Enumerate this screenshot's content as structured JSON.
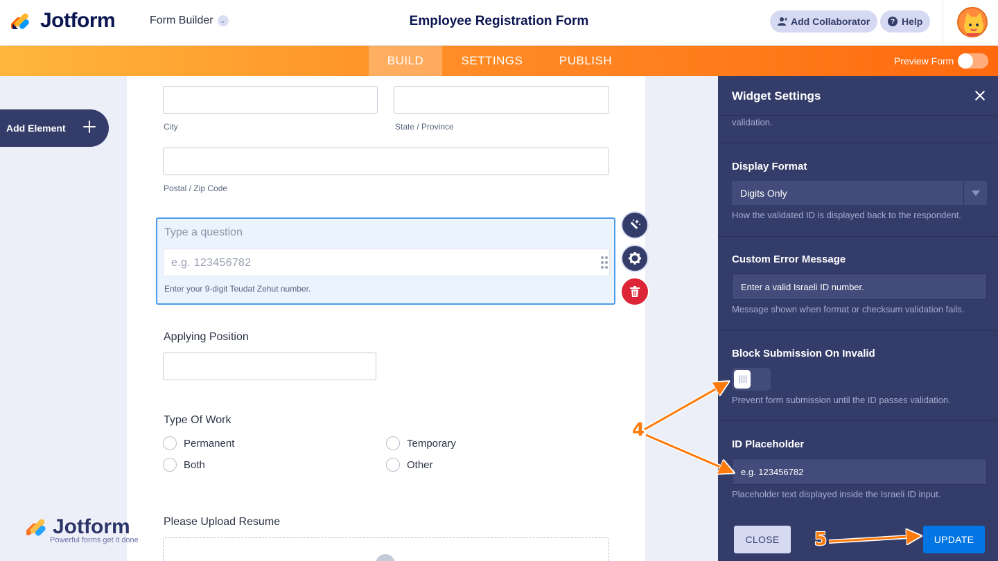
{
  "header": {
    "logo_text": "Jotform",
    "builder_label": "Form Builder",
    "form_title": "Employee Registration Form",
    "add_collaborator": "Add Collaborator",
    "help": "Help"
  },
  "nav": {
    "tabs": [
      "BUILD",
      "SETTINGS",
      "PUBLISH"
    ],
    "active_tab": "BUILD",
    "preview_label": "Preview Form",
    "preview_on": false
  },
  "left": {
    "add_element": "Add Element"
  },
  "form": {
    "city_label": "City",
    "state_label": "State / Province",
    "postal_label": "Postal / Zip Code",
    "selected_question": {
      "title_placeholder": "Type a question",
      "input_placeholder": "e.g. 123456782",
      "sublabel": "Enter your 9-digit Teudat Zehut number."
    },
    "applying_position": "Applying Position",
    "type_of_work": {
      "label": "Type Of Work",
      "options": [
        "Permanent",
        "Temporary",
        "Both",
        "Other"
      ]
    },
    "upload_label": "Please Upload Resume"
  },
  "watermark": {
    "text": "Jotform",
    "tagline": "Powerful forms get it done"
  },
  "panel": {
    "title": "Widget Settings",
    "top_desc": "validation.",
    "display_format": {
      "label": "Display Format",
      "value": "Digits Only",
      "desc": "How the validated ID is displayed back to the respondent."
    },
    "custom_error": {
      "label": "Custom Error Message",
      "value": "Enter a valid Israeli ID number.",
      "desc": "Message shown when format or checksum validation fails."
    },
    "block_submission": {
      "label": "Block Submission On Invalid",
      "enabled": false,
      "desc": "Prevent form submission until the ID passes validation."
    },
    "id_placeholder": {
      "label": "ID Placeholder",
      "value": "e.g. 123456782",
      "desc": "Placeholder text displayed inside the Israeli ID input."
    },
    "close_button": "CLOSE",
    "update_button": "UPDATE"
  },
  "annotations": {
    "step_4": "4",
    "step_5": "5",
    "arrow_color": "#FF7A0A"
  },
  "colors": {
    "brand_orange": "#FF6100",
    "panel_bg": "#343C6A",
    "accent_blue": "#0075E3",
    "selected_border": "#4C9BE8"
  }
}
